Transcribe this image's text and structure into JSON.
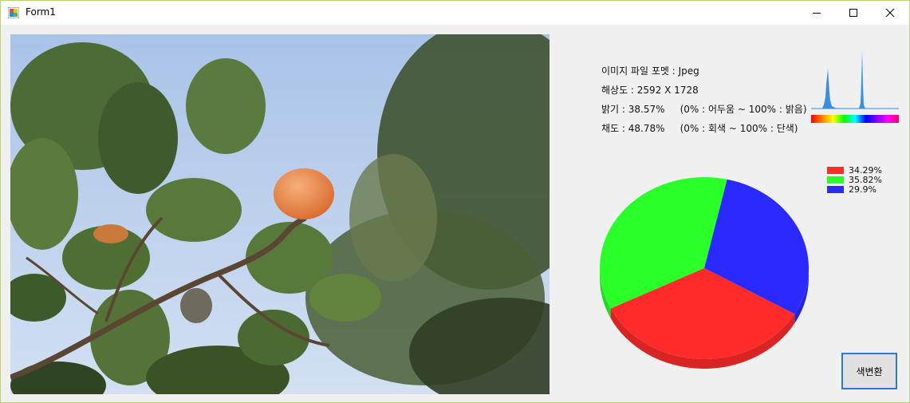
{
  "window": {
    "title": "Form1",
    "icons": {
      "app": "app-icon",
      "minimize": "minimize-icon",
      "maximize": "maximize-icon",
      "close": "close-icon"
    }
  },
  "info": {
    "format": "이미지 파일 포멧 : Jpeg",
    "resolution": "해상도 : 2592 X 1728",
    "brightness": "밝기 : 38.57%     (0% : 어두움 ~ 100% : 밝음)",
    "saturation": "채도 : 48.78%     (0% : 회색 ~ 100% : 단색)"
  },
  "chart_data": {
    "type": "pie",
    "series": [
      {
        "value": 34.29,
        "label": "34.29%",
        "color": "#ff2a2a"
      },
      {
        "value": 35.82,
        "label": "35.82%",
        "color": "#2aff2a"
      },
      {
        "value": 29.9,
        "label": "29.9%",
        "color": "#2a2aff"
      }
    ],
    "legend_placement": "top-right"
  },
  "colors": {
    "accent": "#2b7ad6",
    "red": "#ff2a2a",
    "green": "#2aff2a",
    "blue": "#2a2aff"
  },
  "buttons": {
    "convert": "색변환"
  }
}
